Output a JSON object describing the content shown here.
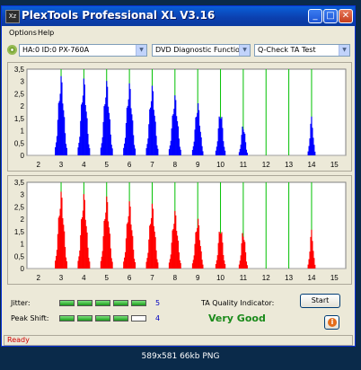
{
  "window": {
    "title": "PlexTools Professional XL V3.16",
    "icon_label": "Xz"
  },
  "title_buttons": {
    "minimize": "_",
    "maximize": "□",
    "close": "✕"
  },
  "menu": [
    "Options",
    "Help"
  ],
  "toolbar": {
    "drive": "HA:0 ID:0  PX-760A",
    "function": "DVD Diagnostic Functions",
    "test": "Q-Check TA Test",
    "arrow": "▼"
  },
  "colors": {
    "top_bars": "#0000ff",
    "bottom_bars": "#ff0000",
    "grid": "#00c000",
    "plot_bg": "#ffffff"
  },
  "chart_data": [
    {
      "type": "bar",
      "name": "top",
      "x_ticks": [
        "2",
        "3",
        "4",
        "5",
        "6",
        "7",
        "8",
        "9",
        "10",
        "11",
        "12",
        "13",
        "14",
        "15"
      ],
      "y_ticks": [
        "0",
        "0,5",
        "1",
        "1,5",
        "2",
        "2,5",
        "3",
        "3,5"
      ],
      "ylim": [
        0,
        3.5
      ],
      "peaks": [
        {
          "x": 3,
          "peak": 3.3,
          "width": 0.5
        },
        {
          "x": 4,
          "peak": 3.2,
          "width": 0.5
        },
        {
          "x": 5,
          "peak": 3.1,
          "width": 0.5
        },
        {
          "x": 6,
          "peak": 3.0,
          "width": 0.5
        },
        {
          "x": 7,
          "peak": 2.9,
          "width": 0.5
        },
        {
          "x": 8,
          "peak": 2.5,
          "width": 0.5
        },
        {
          "x": 9,
          "peak": 2.2,
          "width": 0.45
        },
        {
          "x": 10,
          "peak": 1.9,
          "width": 0.4
        },
        {
          "x": 11,
          "peak": 1.3,
          "width": 0.35
        },
        {
          "x": 14,
          "peak": 1.6,
          "width": 0.3
        }
      ]
    },
    {
      "type": "bar",
      "name": "bottom",
      "x_ticks": [
        "2",
        "3",
        "4",
        "5",
        "6",
        "7",
        "8",
        "9",
        "10",
        "11",
        "12",
        "13",
        "14",
        "15"
      ],
      "y_ticks": [
        "0",
        "0,5",
        "1",
        "1,5",
        "2",
        "2,5",
        "3",
        "3,5"
      ],
      "ylim": [
        0,
        3.5
      ],
      "peaks": [
        {
          "x": 3,
          "peak": 3.2,
          "width": 0.5
        },
        {
          "x": 4,
          "peak": 3.1,
          "width": 0.5
        },
        {
          "x": 5,
          "peak": 3.0,
          "width": 0.5
        },
        {
          "x": 6,
          "peak": 2.8,
          "width": 0.5
        },
        {
          "x": 7,
          "peak": 2.7,
          "width": 0.5
        },
        {
          "x": 8,
          "peak": 2.4,
          "width": 0.5
        },
        {
          "x": 9,
          "peak": 2.1,
          "width": 0.45
        },
        {
          "x": 10,
          "peak": 1.8,
          "width": 0.4
        },
        {
          "x": 11,
          "peak": 1.6,
          "width": 0.35
        },
        {
          "x": 14,
          "peak": 1.6,
          "width": 0.3
        }
      ]
    }
  ],
  "meters": {
    "jitter": {
      "label": "Jitter:",
      "value": "5",
      "filled": 5,
      "total": 5
    },
    "peak_shift": {
      "label": "Peak Shift:",
      "value": "4",
      "filled": 4,
      "total": 5
    }
  },
  "ta_quality": {
    "label": "TA Quality Indicator:",
    "value": "Very Good"
  },
  "buttons": {
    "start": "Start",
    "info": "i"
  },
  "status": {
    "text": "Ready"
  },
  "caption": "589x581 66kb PNG"
}
